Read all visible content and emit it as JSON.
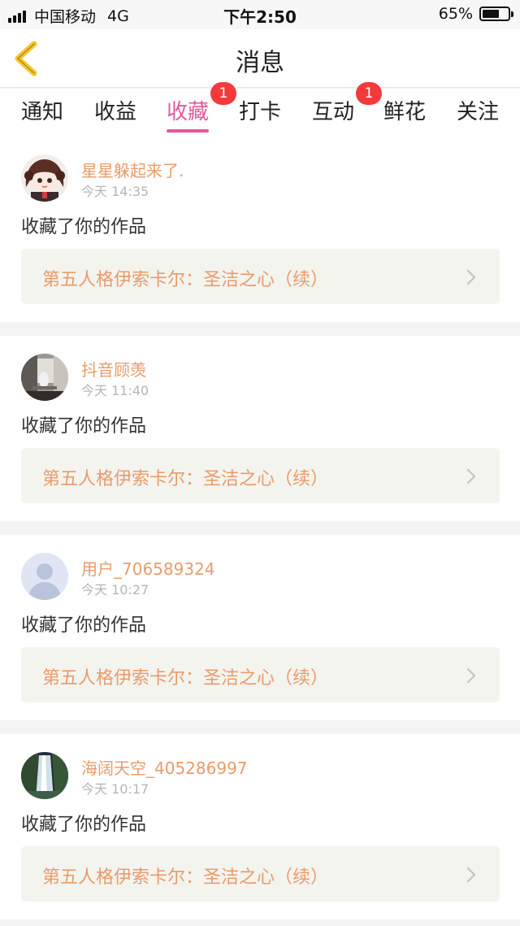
{
  "status_bar": {
    "carrier": "中国移动",
    "network": "4G",
    "time": "下午2:50",
    "battery": "65%",
    "battery_level": 0.65
  },
  "nav": {
    "title": "消息",
    "back_icon": "chevron-left-icon",
    "accent": "#f7c52c"
  },
  "tabs": [
    {
      "label": "通知",
      "badge": ""
    },
    {
      "label": "收益",
      "badge": ""
    },
    {
      "label": "收藏",
      "badge": "1",
      "active": true
    },
    {
      "label": "打卡",
      "badge": ""
    },
    {
      "label": "互动",
      "badge": "1"
    },
    {
      "label": "鲜花",
      "badge": ""
    },
    {
      "label": "关注",
      "badge": ""
    }
  ],
  "colors": {
    "active_tab": "#e05a9c",
    "username": "#e99b6a",
    "badge": "#f23a3c"
  },
  "messages": [
    {
      "username": "星星躲起来了.",
      "time": "今天 14:35",
      "action": "收藏了你的作品",
      "work": "第五人格伊索卡尔：圣洁之心（续）"
    },
    {
      "username": "抖音顾羡",
      "time": "今天 11:40",
      "action": "收藏了你的作品",
      "work": "第五人格伊索卡尔：圣洁之心（续）"
    },
    {
      "username": "用户_706589324",
      "time": "今天 10:27",
      "action": "收藏了你的作品",
      "work": "第五人格伊索卡尔：圣洁之心（续）"
    },
    {
      "username": "海阔天空_405286997",
      "time": "今天 10:17",
      "action": "收藏了你的作品",
      "work": "第五人格伊索卡尔：圣洁之心（续）"
    }
  ]
}
